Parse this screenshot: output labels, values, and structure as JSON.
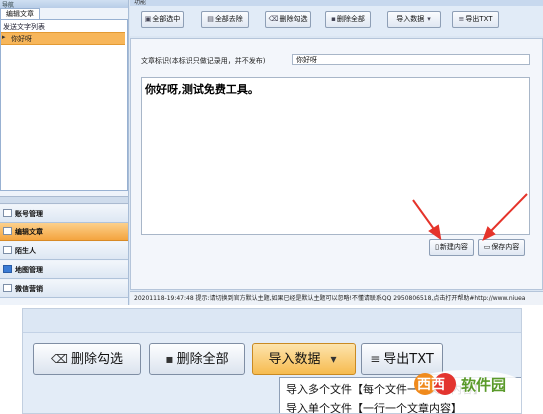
{
  "left_panel": {
    "pane_caption": "导航",
    "tab": "编辑文章",
    "tree_root": "发送文字列表",
    "tree_item": "你好呀",
    "nav": [
      "账号管理",
      "编辑文章",
      "陌生人",
      "地图管理",
      "微信营销"
    ]
  },
  "toolbar": {
    "section_caption": "功能",
    "buttons": [
      "全部选中",
      "全部去除",
      "删除勾选",
      "删除全部",
      "导入数据",
      "导出TXT"
    ]
  },
  "content": {
    "tag_label": "文章标识(本标识只做记录用，并不发布)",
    "tag_value": "你好呀",
    "editor_text": "你好呀,测试免费工具。",
    "new_button": "新建内容",
    "save_button": "保存内容"
  },
  "status_bar": "20201118-19:47:48 提示:请切换到官方默认主题,如果已经是默认主题可以忽略!不懂请联系QQ 2950806518,点击打开帮助#http://www.niuea",
  "zoom": {
    "buttons": [
      "删除勾选",
      "删除全部",
      "导入数据",
      "导出TXT"
    ],
    "menu_items": [
      "导入多个文件【每个文件一个文章内容】",
      "导入单个文件【一行一个文章内容】"
    ]
  },
  "watermark": "西西软件园",
  "colors": {
    "accent": "#f4a43f",
    "panel": "#dbe6f3",
    "arrow": "#e5332a"
  }
}
